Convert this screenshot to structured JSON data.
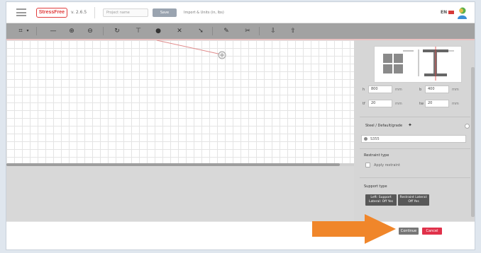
{
  "header": {
    "logo_text": "StressFree",
    "version": "v. 2.6.5",
    "project_placeholder": "Project name",
    "action_button": "Save",
    "note": "Import & Units (in, lbs)",
    "language": "EN"
  },
  "toolbar": {
    "tools": [
      "select-icon",
      "draw-line-icon",
      "zoom-in-icon",
      "zoom-out-icon",
      "refresh-icon",
      "node-icon",
      "fill-icon",
      "cross-icon",
      "cursor-icon",
      "pen-icon",
      "scissors-icon",
      "export-icon",
      "import-icon"
    ]
  },
  "side_panel": {
    "dims": [
      {
        "label": "h",
        "value": "800",
        "unit": "mm"
      },
      {
        "label": "b",
        "value": "400",
        "unit": "mm"
      },
      {
        "label": "tf",
        "value": "20",
        "unit": "mm"
      },
      {
        "label": "tw",
        "value": "20",
        "unit": "mm"
      }
    ],
    "material_label": "Steel / Default/grade",
    "search_value": "S355",
    "restraint_label": "Restraint type",
    "restraint_option": "Apply restraint",
    "support_label": "Support type",
    "support_buttons": [
      "Left: Support Lateral: Off Yes",
      "Restraint Lateral: Off Yes"
    ]
  },
  "footer": {
    "continue_label": "Continue",
    "cancel_label": "Cancel"
  },
  "colors": {
    "accent_red": "#e0314a",
    "arrow_orange": "#f0862a",
    "toolbar_gray": "#a2a2a2"
  }
}
